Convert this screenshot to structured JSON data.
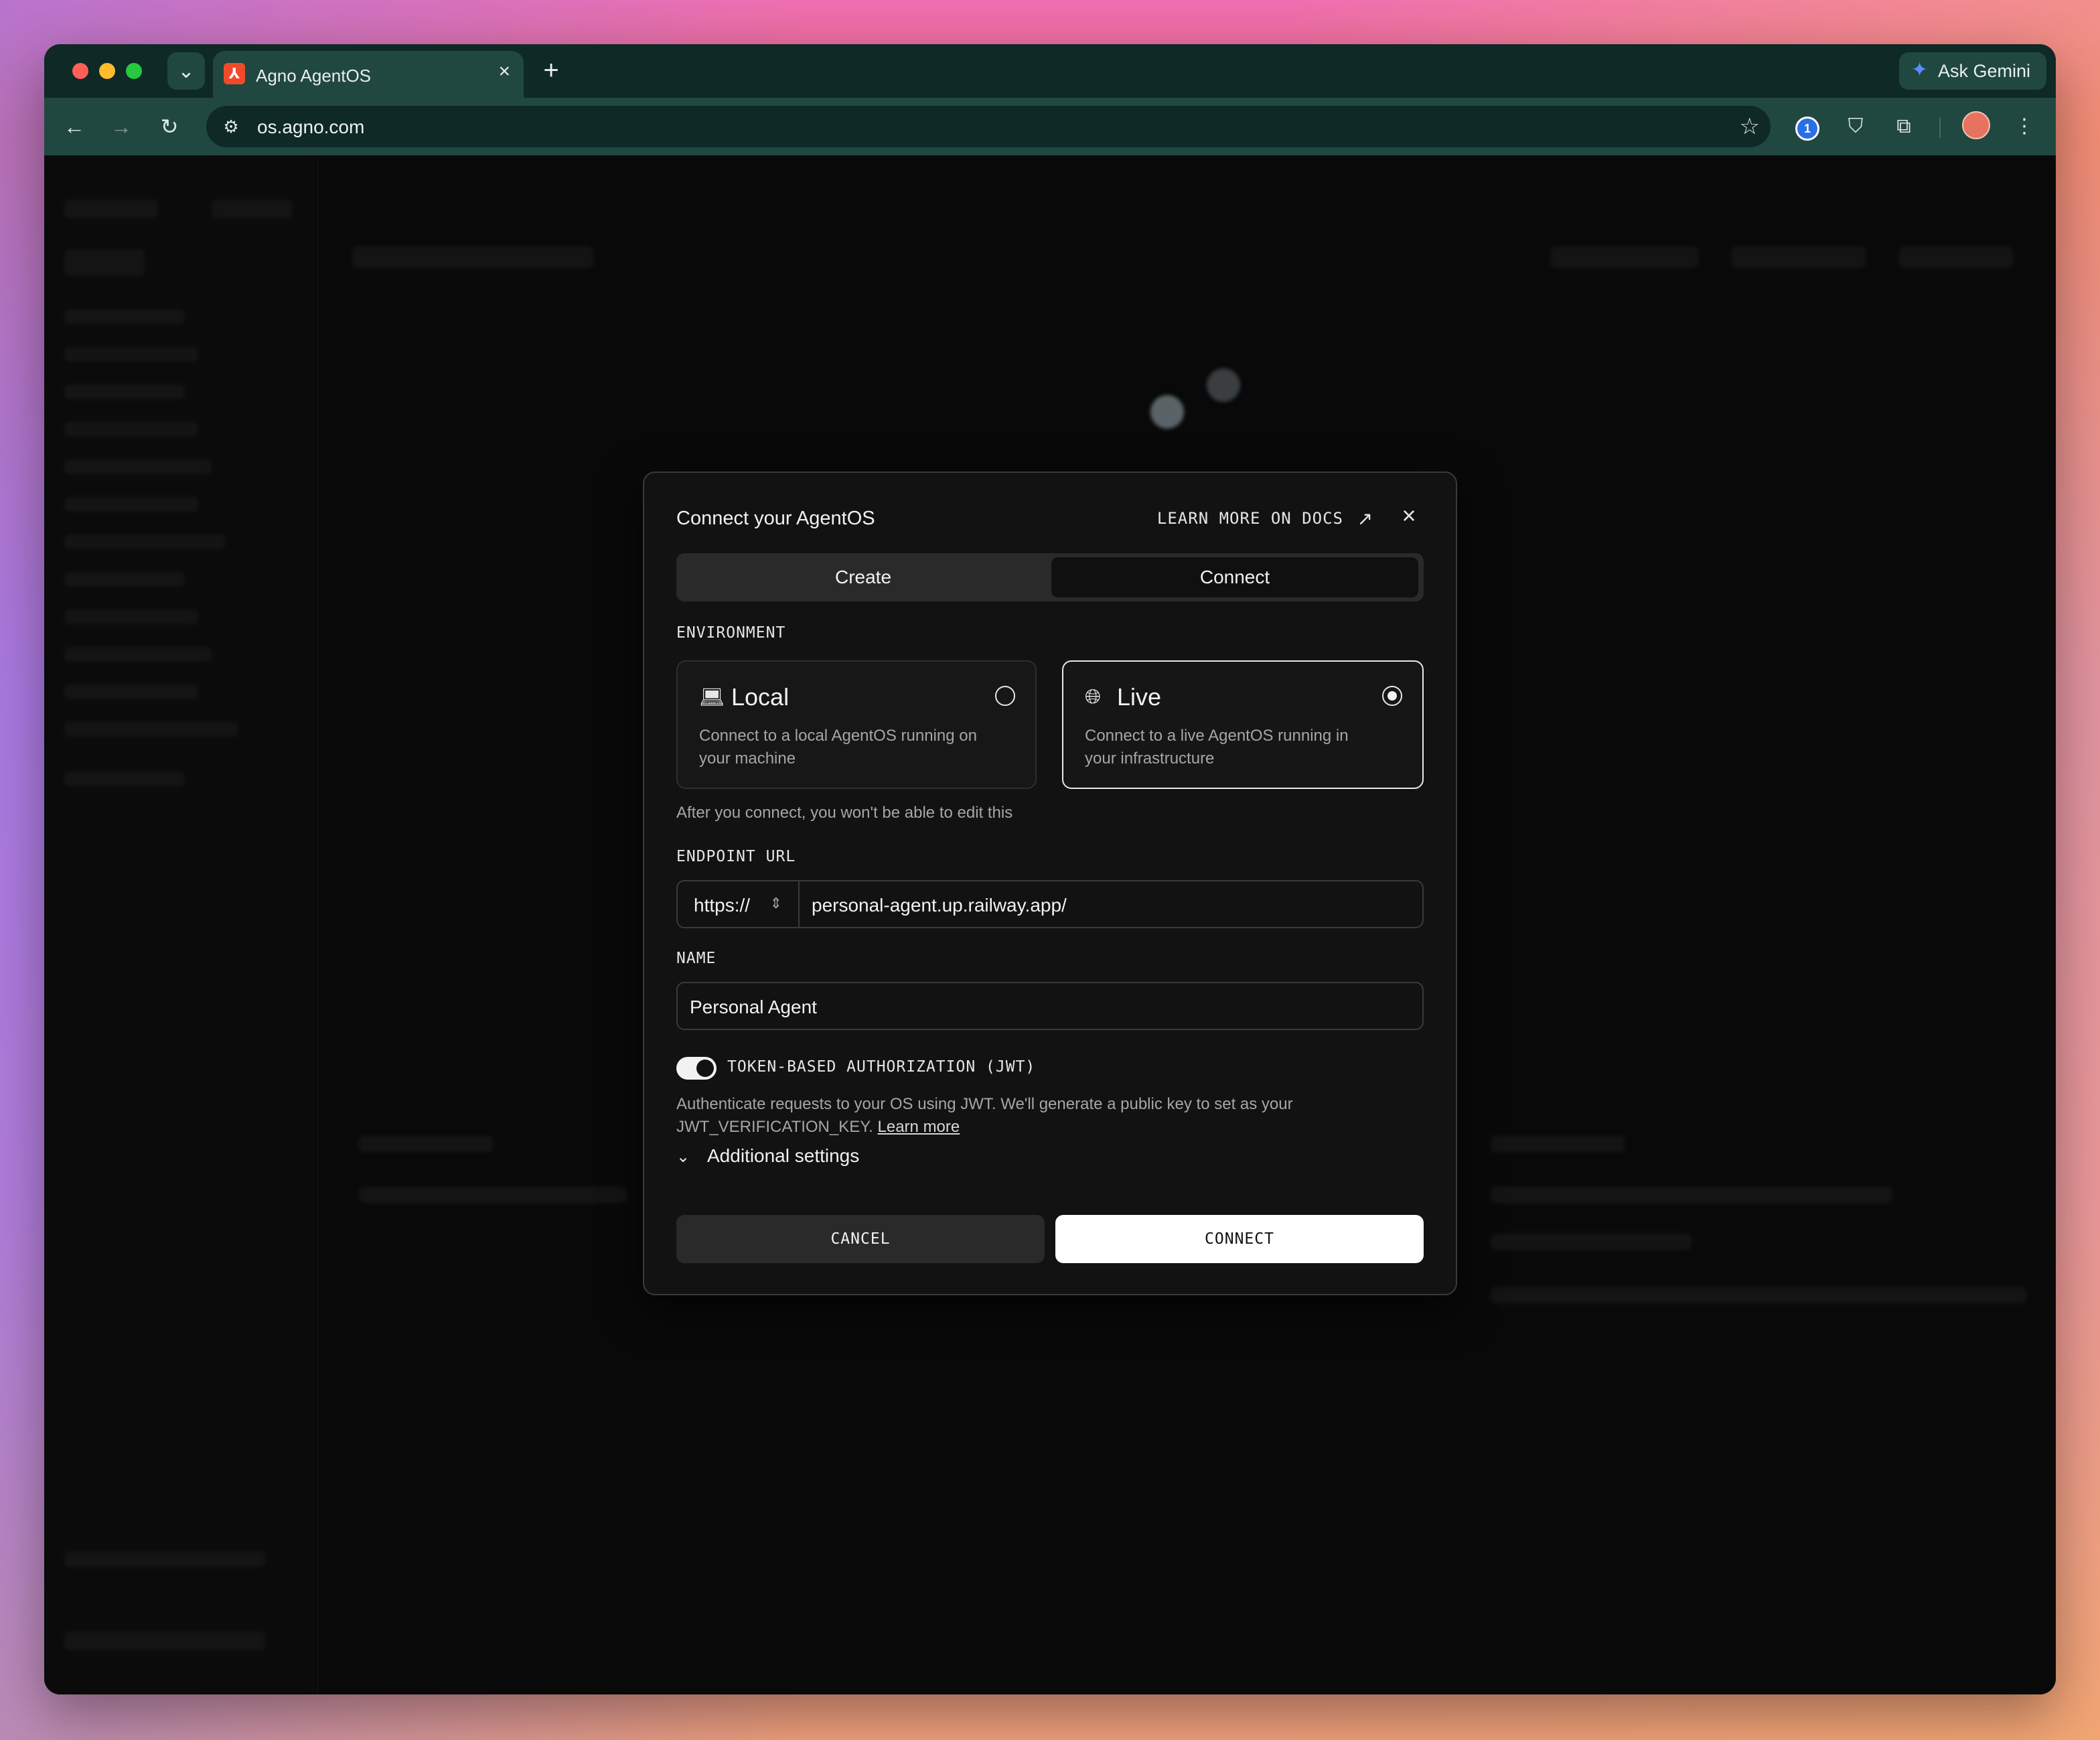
{
  "browser": {
    "tab_title": "Agno AgentOS",
    "tab_close": "×",
    "new_tab": "+",
    "tab_menu_icon": "⌄",
    "gemini_label": "Ask Gemini",
    "url": "os.agno.com",
    "nav": {
      "back": "←",
      "forward": "→",
      "reload": "↻"
    },
    "star": "☆",
    "menu": "⋮"
  },
  "modal": {
    "title": "Connect your AgentOS",
    "docs_link": "LEARN MORE ON DOCS",
    "docs_arrow": "↗",
    "close": "×",
    "tabs": [
      {
        "label": "Create",
        "active": false
      },
      {
        "label": "Connect",
        "active": true
      }
    ],
    "environment_label": "ENVIRONMENT",
    "environments": [
      {
        "name": "Local",
        "icon": "laptop-icon",
        "description": "Connect to a local AgentOS running on your machine",
        "selected": false
      },
      {
        "name": "Live",
        "icon": "globe-icon",
        "description": "Connect to a live AgentOS running in your infrastructure",
        "selected": true
      }
    ],
    "environment_help": "After you connect, you won't be able to edit this",
    "endpoint_label": "ENDPOINT URL",
    "protocol": "https://",
    "protocol_chevron": "⌃⌄",
    "endpoint_value": "personal-agent.up.railway.app/",
    "name_label": "NAME",
    "name_value": "Personal Agent",
    "jwt_toggle_on": true,
    "jwt_label": "TOKEN-BASED AUTHORIZATION (JWT)",
    "jwt_description": "Authenticate requests to your OS using JWT. We'll generate a public key to set as your JWT_VERIFICATION_KEY.",
    "jwt_learn_more": "Learn more",
    "additional_settings": "Additional settings",
    "cancel_label": "CANCEL",
    "connect_label": "CONNECT"
  },
  "colors": {
    "modal_bg": "#121212",
    "primary_button": "#ffffff",
    "browser_frame": "#0e2926",
    "browser_toolbar": "#214741"
  }
}
